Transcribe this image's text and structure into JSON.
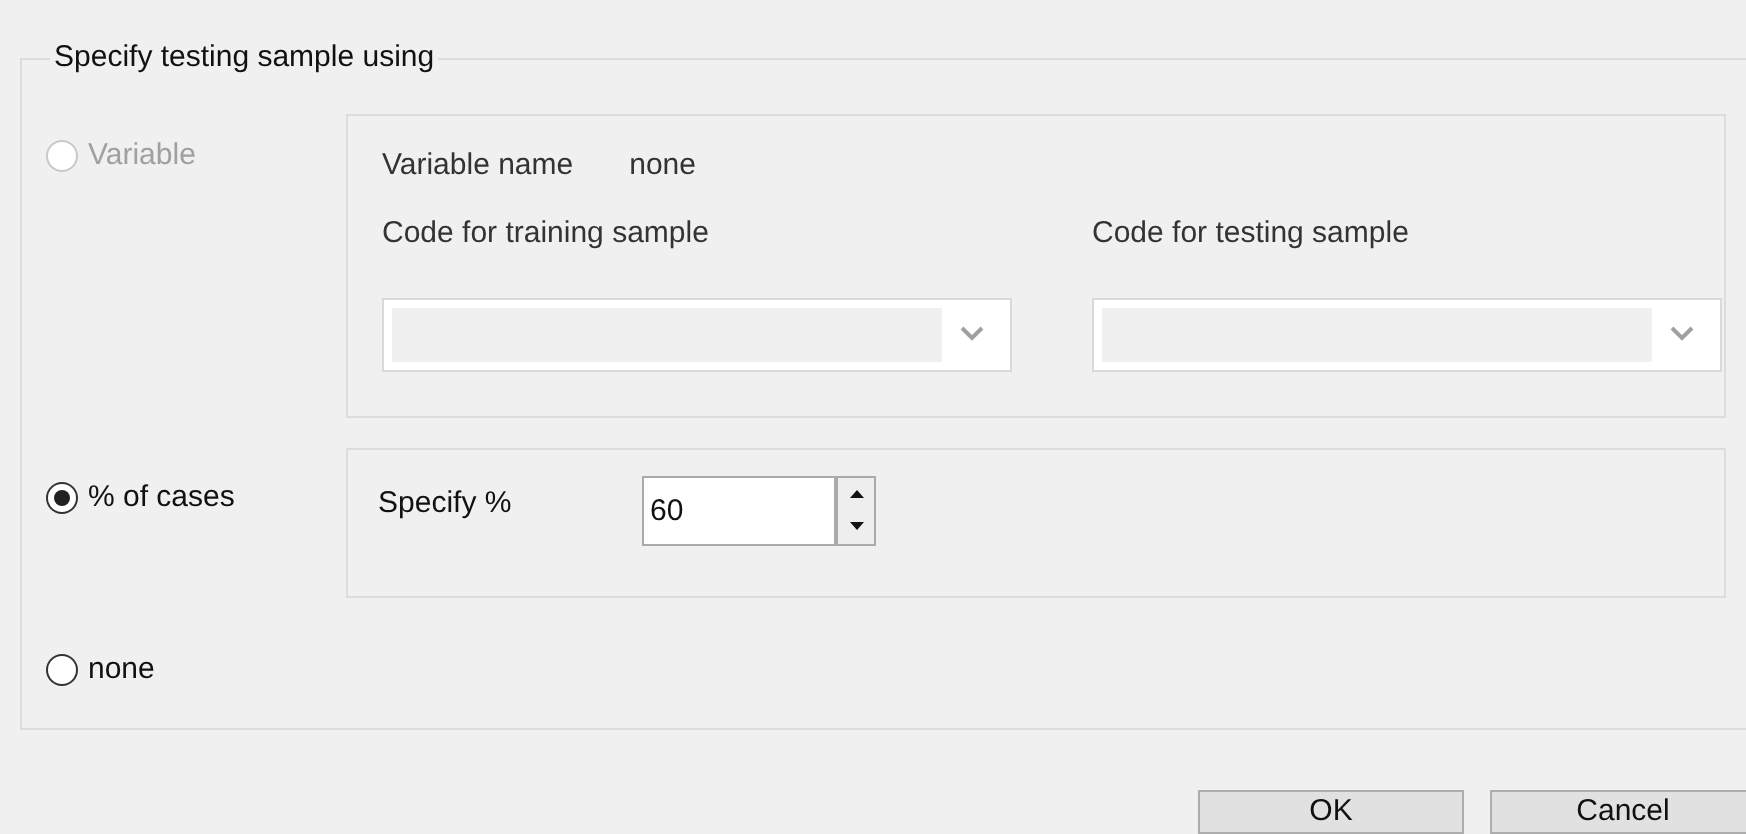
{
  "group": {
    "title": "Specify testing sample using"
  },
  "options": [
    {
      "kind": "variable",
      "label": "Variable",
      "selected": false,
      "disabled": true
    },
    {
      "kind": "percent",
      "label": "% of cases",
      "selected": true,
      "disabled": false
    },
    {
      "kind": "none",
      "label": "none",
      "selected": false,
      "disabled": false
    }
  ],
  "variable_panel": {
    "name_label": "Variable name",
    "name_value": "none",
    "training_label": "Code for training sample",
    "testing_label": "Code for testing sample"
  },
  "percent_panel": {
    "label": "Specify %",
    "value": "60"
  },
  "buttons": [
    "OK",
    "Cancel"
  ]
}
